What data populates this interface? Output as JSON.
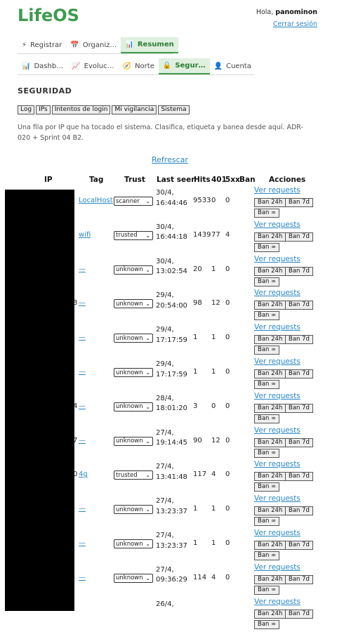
{
  "app": {
    "title": "LifeOS"
  },
  "user": {
    "greeting": "Hola,",
    "name": "panominon",
    "logout": "Cerrar sesión"
  },
  "main_tabs": [
    {
      "icon": "⚡",
      "label": "Registrar",
      "active": false
    },
    {
      "icon": "📅",
      "label": "Organiz…",
      "active": false
    },
    {
      "icon": "📊",
      "label": "Resumen",
      "active": true
    }
  ],
  "sub_tabs": [
    {
      "icon": "📊",
      "label": "Dashb…",
      "active": false
    },
    {
      "icon": "📈",
      "label": "Evoluc…",
      "active": false
    },
    {
      "icon": "🧭",
      "label": "Norte",
      "active": false
    },
    {
      "icon": "🔒",
      "label": "Segur…",
      "active": true
    },
    {
      "icon": "👤",
      "label": "Cuenta",
      "active": false
    }
  ],
  "section": {
    "title": "SEGURIDAD",
    "subtabs": [
      "Log",
      "IPs",
      "Intentos de login",
      "Mi vigilancia",
      "Sistema"
    ],
    "description": "Una fila por IP que ha tocado el sistema. Clasifica, etiqueta y banea desde aquí. ADR-020 + Sprint 04 B2.",
    "refresh": "Refrescar"
  },
  "table": {
    "headers": {
      "ip": "IP",
      "tag": "Tag",
      "trust": "Trust",
      "last_seen": "Last seen",
      "hits": "Hits",
      "c401": "401",
      "c5xx": "5xx",
      "ban": "Ban",
      "actions": "Acciones"
    },
    "actions": {
      "view": "Ver requests",
      "ban24": "Ban 24h",
      "ban7": "Ban 7d",
      "banInf": "Ban ∞"
    },
    "rows": [
      {
        "ipfrag": "",
        "tag": "LocalHost",
        "trust": "scanner",
        "date": "30/4,",
        "time": "16:44:46",
        "hits": "9533",
        "c401": "0",
        "c5xx": "0"
      },
      {
        "ipfrag": "",
        "tag": "wifi",
        "trust": "trusted",
        "date": "30/4,",
        "time": "16:44:18",
        "hits": "1439",
        "c401": "77",
        "c5xx": "4"
      },
      {
        "ipfrag": "",
        "tag": "—",
        "trust": "unknown",
        "date": "30/4,",
        "time": "13:02:54",
        "hits": "20",
        "c401": "1",
        "c5xx": "0"
      },
      {
        "ipfrag": "3",
        "tag": "—",
        "trust": "unknown",
        "date": "29/4,",
        "time": "20:54:00",
        "hits": "98",
        "c401": "12",
        "c5xx": "0"
      },
      {
        "ipfrag": "",
        "tag": "—",
        "trust": "unknown",
        "date": "29/4,",
        "time": "17:17:59",
        "hits": "1",
        "c401": "1",
        "c5xx": "0"
      },
      {
        "ipfrag": "",
        "tag": "—",
        "trust": "unknown",
        "date": "29/4,",
        "time": "17:17:59",
        "hits": "1",
        "c401": "1",
        "c5xx": "0"
      },
      {
        "ipfrag": "4",
        "tag": "—",
        "trust": "unknown",
        "date": "28/4,",
        "time": "18:01:20",
        "hits": "3",
        "c401": "0",
        "c5xx": "0"
      },
      {
        "ipfrag": "7",
        "tag": "—",
        "trust": "unknown",
        "date": "27/4,",
        "time": "19:14:45",
        "hits": "90",
        "c401": "12",
        "c5xx": "0"
      },
      {
        "ipfrag": "0",
        "tag": "4g",
        "trust": "trusted",
        "date": "27/4,",
        "time": "13:41:48",
        "hits": "117",
        "c401": "4",
        "c5xx": "0"
      },
      {
        "ipfrag": "",
        "tag": "—",
        "trust": "unknown",
        "date": "27/4,",
        "time": "13:23:37",
        "hits": "1",
        "c401": "1",
        "c5xx": "0"
      },
      {
        "ipfrag": "",
        "tag": "—",
        "trust": "unknown",
        "date": "27/4,",
        "time": "13:23:37",
        "hits": "1",
        "c401": "1",
        "c5xx": "0"
      },
      {
        "ipfrag": "",
        "tag": "—",
        "trust": "unknown",
        "date": "27/4,",
        "time": "09:36:29",
        "hits": "114",
        "c401": "4",
        "c5xx": "0"
      },
      {
        "ipfrag": "",
        "tag": "",
        "trust": "",
        "date": "26/4,",
        "time": "",
        "hits": "",
        "c401": "",
        "c5xx": ""
      }
    ]
  },
  "colors": {
    "brand": "#3e9b4f",
    "link": "#2a87c4",
    "active_tab_bg": "#dff0df"
  }
}
